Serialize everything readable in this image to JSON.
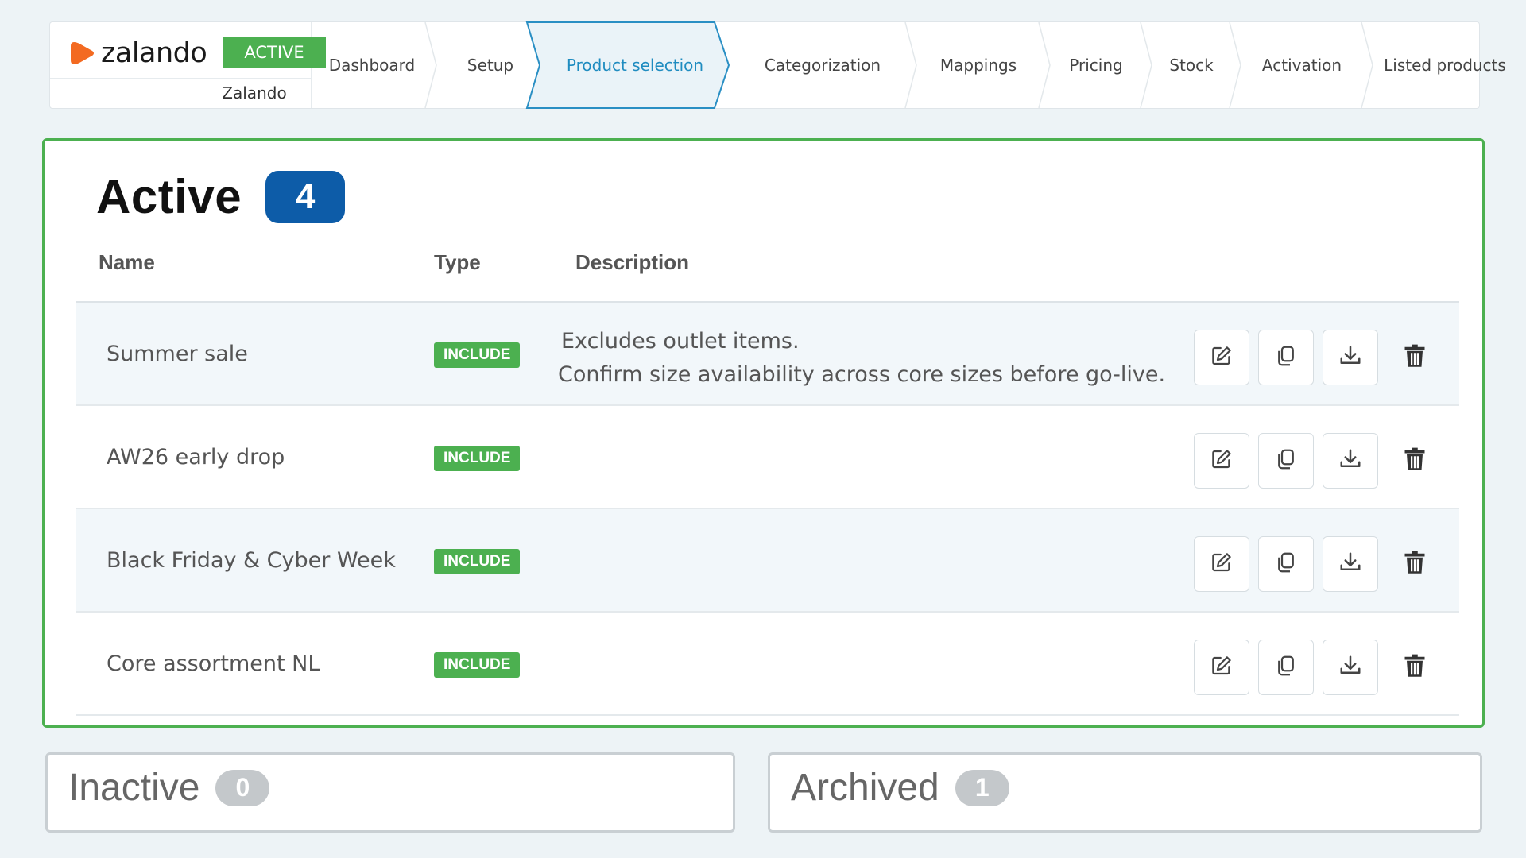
{
  "brand": {
    "name": "zalando",
    "status": "ACTIVE",
    "account": "Zalando",
    "logo_color": "#f36a21"
  },
  "steps": [
    {
      "label": "Dashboard"
    },
    {
      "label": "Setup"
    },
    {
      "label": "Product selection",
      "current": true
    },
    {
      "label": "Categorization"
    },
    {
      "label": "Mappings"
    },
    {
      "label": "Pricing"
    },
    {
      "label": "Stock"
    },
    {
      "label": "Activation"
    },
    {
      "label": "Listed products"
    }
  ],
  "active_section": {
    "title": "Active",
    "count": "4",
    "columns": {
      "name": "Name",
      "type": "Type",
      "description": "Description"
    },
    "rows": [
      {
        "name": "Summer sale",
        "type": "INCLUDE",
        "description": [
          "Excludes outlet items.",
          "Confirm size availability across core sizes before go-live."
        ]
      },
      {
        "name": "AW26 early drop",
        "type": "INCLUDE",
        "description": []
      },
      {
        "name": "Black Friday & Cyber Week",
        "type": "INCLUDE",
        "description": []
      },
      {
        "name": "Core assortment NL",
        "type": "INCLUDE",
        "description": []
      }
    ]
  },
  "inactive_section": {
    "title": "Inactive",
    "count": "0"
  },
  "archived_section": {
    "title": "Archived",
    "count": "1"
  },
  "colors": {
    "accent_green": "#4cb050",
    "accent_blue": "#0d5ca8",
    "current_step": "#1f8cc0"
  }
}
